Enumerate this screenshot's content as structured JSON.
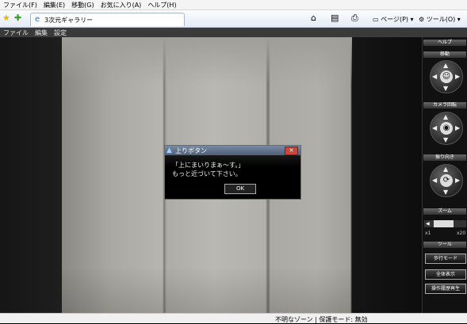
{
  "menu": [
    "ファイル(F)",
    "編集(E)",
    "移動(G)",
    "お気に入り(A)",
    "ヘルプ(H)"
  ],
  "tab": {
    "title": "3次元ギャラリー"
  },
  "toolbar": {
    "page_label": "ページ(P)",
    "tools_label": "ツール(O)"
  },
  "app_menu": [
    "ファイル",
    "編集",
    "設定"
  ],
  "dialog": {
    "title": "上りボタン",
    "message": "「上にまいりまぁ〜す。」\nもっと近づいて下さい。",
    "ok_label": "OK"
  },
  "panel": {
    "help": "ヘルプ",
    "move": "移動",
    "camera_rotate": "カメラ回転",
    "face_direction": "振り向き",
    "zoom": "ズーム",
    "zoom_min": "x1",
    "zoom_max": "x20",
    "tools": "ツール",
    "walk_mode": "歩行モード",
    "overview": "全体表示",
    "history_replay": "操作履歴再生"
  },
  "status": {
    "text": "不明なゾーン | 保護モード: 無効"
  }
}
